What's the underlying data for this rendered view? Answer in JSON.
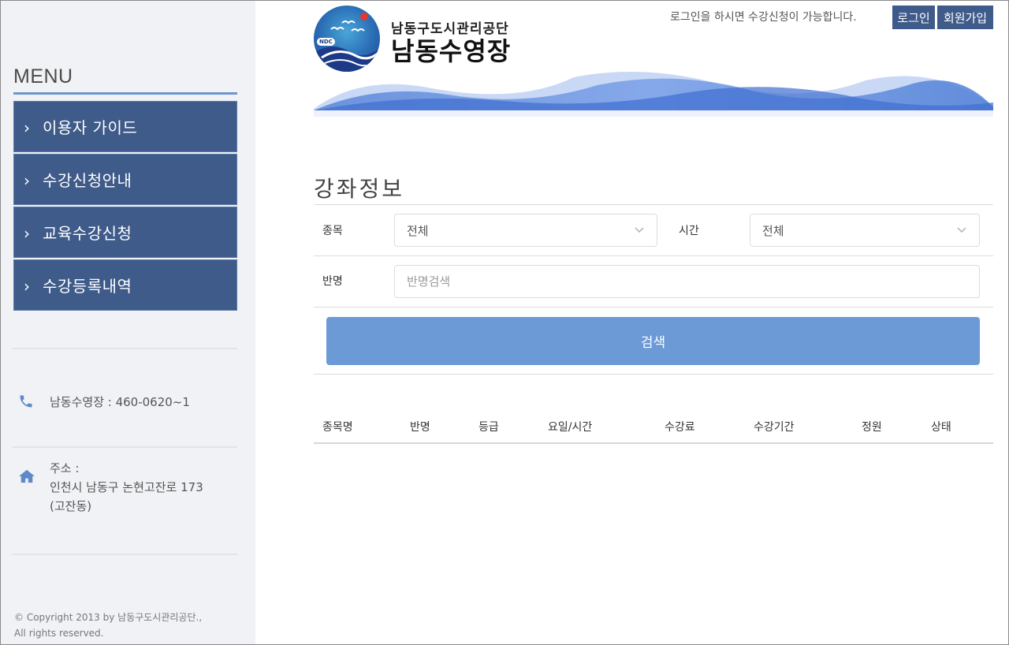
{
  "sidebar": {
    "menu_title": "MENU",
    "items": [
      {
        "label": "이용자 가이드"
      },
      {
        "label": "수강신청안내"
      },
      {
        "label": "교육수강신청"
      },
      {
        "label": "수강등록내역"
      }
    ],
    "phone": "남동수영장 : 460-0620~1",
    "address_label": "주소 :",
    "address_line1": "인천시 남동구 논현고잔로 173",
    "address_line2": "(고잔동)",
    "copyright_line1": "© Copyright 2013 by 남동구도시관리공단.,",
    "copyright_line2": "All rights reserved."
  },
  "header": {
    "logo_org": "남동구도시관리공단",
    "logo_name": "남동수영장",
    "logo_badge": "NDC",
    "login_message": "로그인을 하시면 수강신청이 가능합니다.",
    "login_button": "로그인",
    "signup_button": "회원가입"
  },
  "main": {
    "page_title": "강좌정보",
    "filters": {
      "sport_label": "종목",
      "sport_value": "전체",
      "time_label": "시간",
      "time_value": "전체",
      "class_label": "반명",
      "class_placeholder": "반명검색",
      "search_button": "검색"
    },
    "table_headers": [
      "종목명",
      "반명",
      "등급",
      "요일/시간",
      "수강료",
      "수강기간",
      "정원",
      "상태"
    ]
  },
  "colors": {
    "menu_bg": "#3f5b8a",
    "accent": "#6b9ad6",
    "sidebar_bg": "#f1f2f5"
  }
}
